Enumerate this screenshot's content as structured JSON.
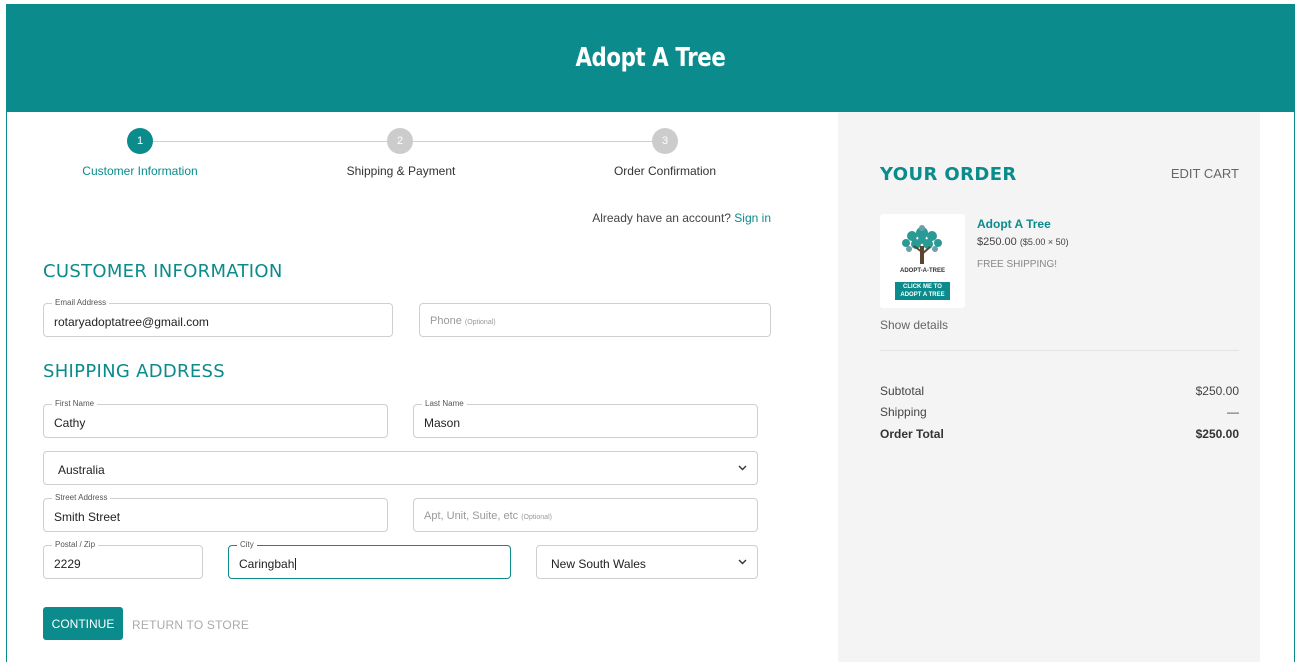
{
  "header": {
    "title": "Adopt A Tree"
  },
  "steps": [
    {
      "number": "1",
      "label": "Customer Information"
    },
    {
      "number": "2",
      "label": "Shipping & Payment"
    },
    {
      "number": "3",
      "label": "Order Confirmation"
    }
  ],
  "account": {
    "prompt": "Already have an account?",
    "signin": "Sign in"
  },
  "customer": {
    "title": "CUSTOMER INFORMATION",
    "email_label": "Email Address",
    "email_value": "rotaryadoptatree@gmail.com",
    "phone_placeholder": "Phone",
    "phone_optional": "(Optional)"
  },
  "shipping": {
    "title": "SHIPPING ADDRESS",
    "first_label": "First Name",
    "first_value": "Cathy",
    "last_label": "Last Name",
    "last_value": "Mason",
    "country_value": "Australia",
    "street_label": "Street Address",
    "street_value": "Smith Street",
    "apt_placeholder": "Apt, Unit, Suite, etc",
    "apt_optional": "(Optional)",
    "postal_label": "Postal / Zip",
    "postal_value": "2229",
    "city_label": "City",
    "city_value": "Caringbah",
    "state_value": "New South Wales"
  },
  "actions": {
    "continue": "CONTINUE",
    "return": "RETURN TO STORE"
  },
  "order": {
    "title": "YOUR ORDER",
    "edit_cart": "EDIT CART",
    "product_name": "Adopt A Tree",
    "product_price": "$250.00",
    "product_unit": "($5.00 × 50)",
    "product_shipping": "FREE SHIPPING!",
    "thumb_brand": "ADOPT-A-TREE",
    "thumb_cta_1": "CLICK ME TO",
    "thumb_cta_2": "ADOPT A TREE",
    "show_details": "Show details",
    "subtotal_label": "Subtotal",
    "subtotal_value": "$250.00",
    "shipping_label": "Shipping",
    "shipping_value": "—",
    "total_label": "Order Total",
    "total_value": "$250.00"
  },
  "colors": {
    "accent": "#0b8b8b",
    "panel": "#f4f4f4",
    "inactive_step": "#cccccc"
  }
}
